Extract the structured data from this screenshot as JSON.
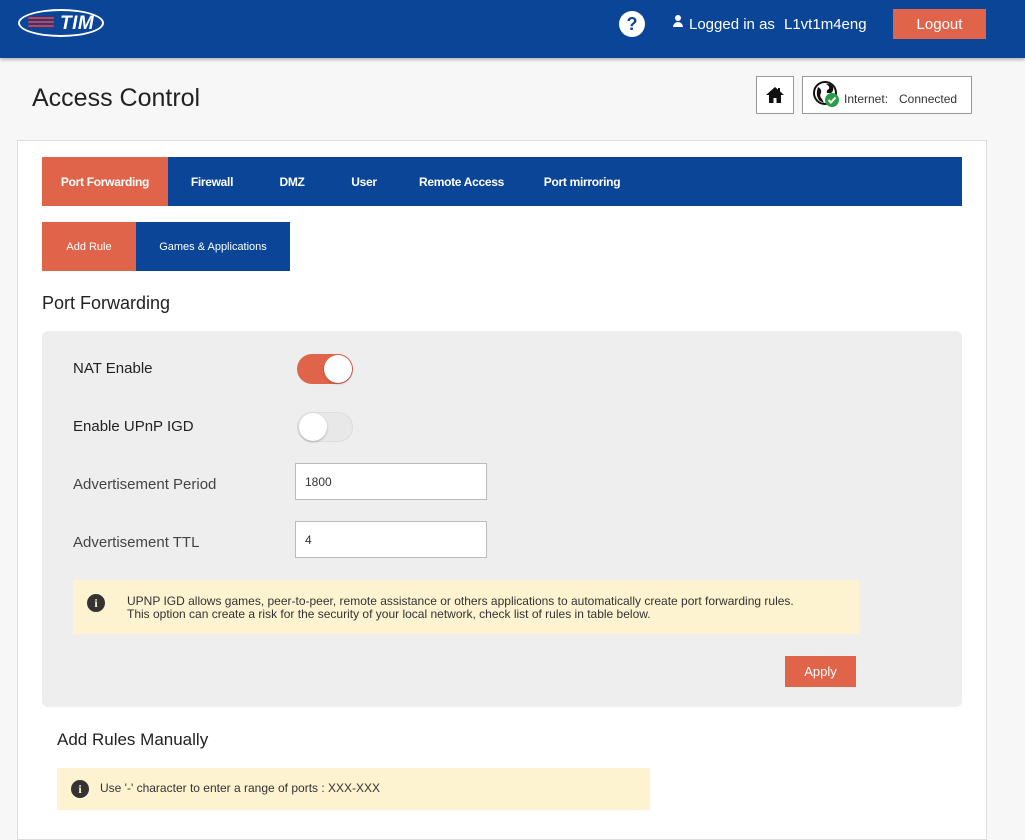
{
  "header": {
    "logo_text": "TIM",
    "help_symbol": "?",
    "logged_in_label": "Logged in as",
    "username": "L1vt1m4eng",
    "logout_label": "Logout"
  },
  "page": {
    "title": "Access Control",
    "internet_label": "Internet:",
    "internet_status": "Connected"
  },
  "tabs": [
    {
      "label": "Port Forwarding",
      "active": true
    },
    {
      "label": "Firewall",
      "active": false
    },
    {
      "label": "DMZ",
      "active": false
    },
    {
      "label": "User",
      "active": false
    },
    {
      "label": "Remote Access",
      "active": false
    },
    {
      "label": "Port mirroring",
      "active": false
    }
  ],
  "subtabs": [
    {
      "label": "Add Rule",
      "active": true
    },
    {
      "label": "Games & Applications",
      "active": false
    }
  ],
  "port_forwarding": {
    "title": "Port Forwarding",
    "nat_enable_label": "NAT Enable",
    "nat_enable": true,
    "upnp_label": "Enable UPnP IGD",
    "upnp_enable": false,
    "adv_period_label": "Advertisement Period",
    "adv_period_value": "1800",
    "adv_ttl_label": "Advertisement TTL",
    "adv_ttl_value": "4",
    "info_line1": "UPNP IGD allows games, peer-to-peer, remote assistance or others applications to automatically create port forwarding rules.",
    "info_line2": "This option can create a risk for the security of your local network, check list of rules in table below.",
    "apply_label": "Apply"
  },
  "manual_rules": {
    "title": "Add Rules Manually",
    "info_text": "Use '-' character to enter a range of ports : XXX-XXX"
  },
  "colors": {
    "brand_blue": "#0a4597",
    "accent_orange": "#e0644a",
    "info_bg": "#fdf3d0"
  },
  "icons": [
    "tim-logo-icon",
    "help-icon",
    "user-icon",
    "home-icon",
    "globe-check-icon",
    "info-icon"
  ]
}
